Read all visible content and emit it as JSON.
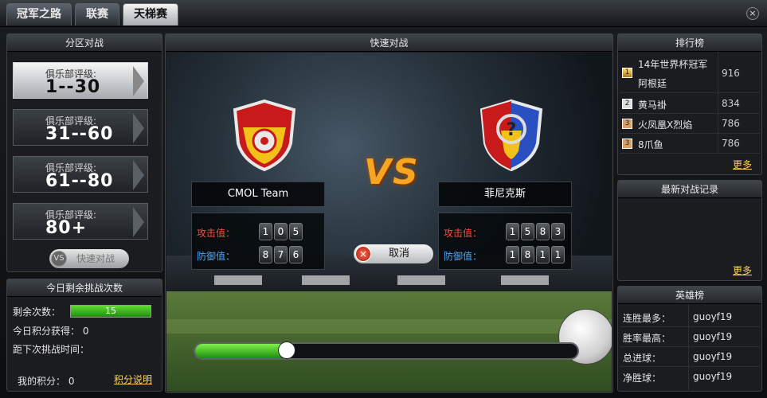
{
  "tabs": [
    {
      "label": "冠军之路"
    },
    {
      "label": "联赛"
    },
    {
      "label": "天梯赛"
    }
  ],
  "close_label": "×",
  "zone_panel": {
    "title": "分区对战",
    "zones": [
      {
        "label": "俱乐部评级:",
        "range": "1--30"
      },
      {
        "label": "俱乐部评级:",
        "range": "31--60"
      },
      {
        "label": "俱乐部评级:",
        "range": "61--80"
      },
      {
        "label": "俱乐部评级:",
        "range": "80+"
      }
    ],
    "quick_battle": "快速对战"
  },
  "today": {
    "title": "今日剩余挑战次数",
    "remaining_label": "剩余次数：",
    "remaining_value": "15",
    "points_label": "今日积分获得：",
    "points_value": "0",
    "next_label": "距下次挑战时间：",
    "my_points_label": "我的积分：",
    "my_points_value": "0",
    "points_help": "积分说明"
  },
  "battle": {
    "title": "快速对战",
    "vs": "VS",
    "left": {
      "name": "CMOL Team",
      "attack_label": "攻击值：",
      "attack": [
        "1",
        "0",
        "5"
      ],
      "defense_label": "防御值：",
      "defense": [
        "8",
        "7",
        "6"
      ]
    },
    "right": {
      "name": "菲尼克斯",
      "attack_label": "攻击值：",
      "attack": [
        "1",
        "5",
        "8",
        "3"
      ],
      "defense_label": "防御值：",
      "defense": [
        "1",
        "8",
        "1",
        "1"
      ]
    },
    "cancel": "取消",
    "progress": 0.24
  },
  "ranking": {
    "title": "排行榜",
    "rows": [
      {
        "rank": "1",
        "name1": "14年世界杯冠军",
        "name2": "阿根廷",
        "score": "916"
      },
      {
        "rank": "2",
        "name1": "黄马褂",
        "score": "834"
      },
      {
        "rank": "3",
        "name1": "火凤凰X烈焰",
        "score": "786"
      },
      {
        "rank": "3",
        "name1": "8爪鱼",
        "score": "786"
      }
    ],
    "more": "更多"
  },
  "recent": {
    "title": "最新对战记录",
    "more": "更多"
  },
  "heroes": {
    "title": "英雄榜",
    "rows": [
      {
        "k": "连胜最多：",
        "v": "guoyf19"
      },
      {
        "k": "胜率最高：",
        "v": "guoyf19"
      },
      {
        "k": "总进球：",
        "v": "guoyf19"
      },
      {
        "k": "净胜球：",
        "v": "guoyf19"
      }
    ]
  },
  "colors": {
    "accent": "#f5a623",
    "attack_label": "#ff4a3a",
    "defense_label": "#4aa8ff",
    "link": "#ffd34a",
    "progress": "#3fbf22"
  }
}
